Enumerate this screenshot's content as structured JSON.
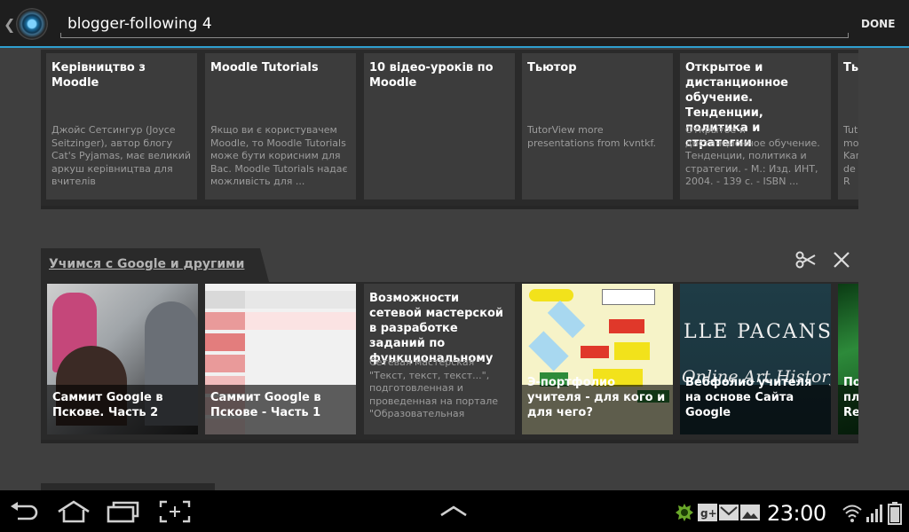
{
  "action_bar": {
    "search_query": "blogger-following 4",
    "done_label": "DONE"
  },
  "panel1": {
    "cards": [
      {
        "title": "Керівництво з Moodle",
        "description": "Джойс Сетсингур (Joyce Seitzinger), автор блогу Cat's Pyjamas, має великий аркуш керівництва для вчителів"
      },
      {
        "title": "Moodle Tutorials",
        "description": "Якщо ви є користувачем Moodle, то Moodle Tutorials може бути корисним для Вас. Moodle Tutorials надає можливість для ..."
      },
      {
        "title": "10 відео-уроків по Moodle",
        "description": ""
      },
      {
        "title": "Тьютор",
        "description": "TutorView more presentations from kvntkf."
      },
      {
        "title": "Открытое и дистанционное обучение. Тенденции, политика и стратегии",
        "description": "Открытое и дистанционное обучение. Тенденции, политика и стратегии. - М.: Изд. ИНТ, 2004. - 139 с. - ISBN ..."
      },
      {
        "title": "Ты",
        "description": "Tut mo Kar de R"
      }
    ]
  },
  "panel2": {
    "section_title": "Учимся с Google и другими",
    "cards": [
      {
        "title": "Саммит Google в Пскове. Часть 2"
      },
      {
        "title": "Саммит Google в Пскове - Часть 1"
      },
      {
        "title": "Возможности сетевой мастерской в разработке заданий по функциональному",
        "description": "Сетевая мастерская \"Текст, текст, текст...\", подготовленная и проведенная на портале \"Образовательная"
      },
      {
        "title": "Э-портфолио учителя - для кого и для чего?"
      },
      {
        "title": "Вебфолио учителя на основе Сайта Google",
        "image_text_1": "LLE PACANSI",
        "image_text_2": "Online Art History"
      },
      {
        "title": "По пла Rea"
      }
    ]
  },
  "system_bar": {
    "clock": "23:00"
  }
}
